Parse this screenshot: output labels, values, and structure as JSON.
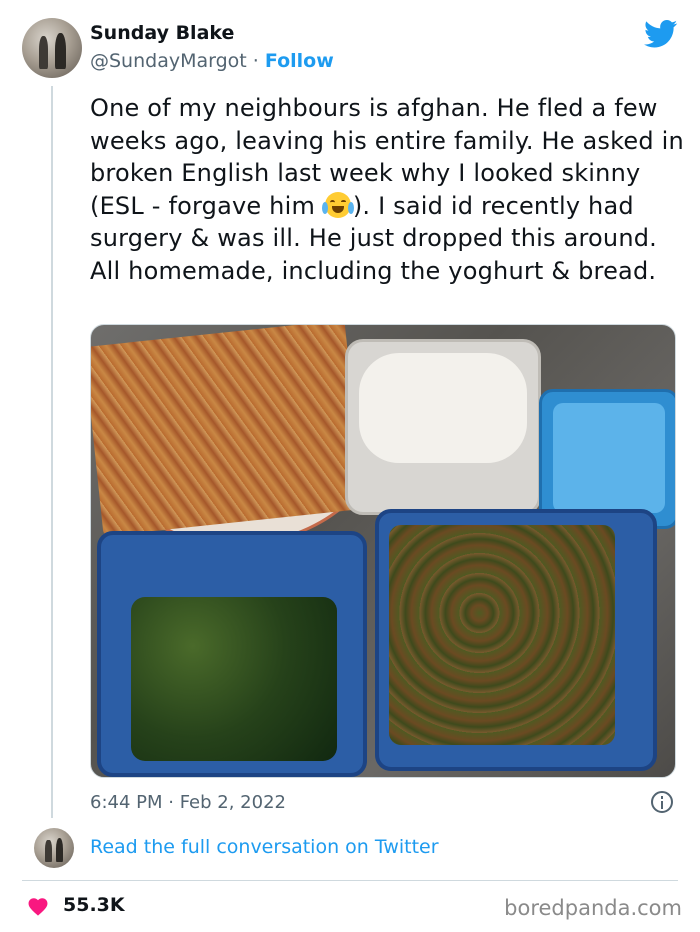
{
  "author": {
    "display_name": "Sunday Blake",
    "handle": "@SundayMargot",
    "separator": " · ",
    "follow_label": "Follow"
  },
  "tweet": {
    "text_before_emoji": "One of my neighbours is afghan. He fled a few weeks ago, leaving his entire family. He asked in broken English last week why I looked skinny (ESL - forgave him ",
    "emoji": "face-with-tears-of-joy",
    "text_after_emoji": "). I said id recently had surgery & was ill. He just dropped this around. All homemade, including the yoghurt & bread.",
    "timestamp": "6:44 PM · Feb 2, 2022"
  },
  "footer": {
    "read_link": "Read the full conversation on Twitter",
    "likes": "55.3K",
    "watermark": "boredpanda.com"
  },
  "icons": {
    "brand": "twitter-bird-icon",
    "info": "info-icon",
    "like": "heart-icon"
  },
  "colors": {
    "accent": "#1d9bf0",
    "text": "#0f1419",
    "muted": "#536471",
    "heart": "#f91880"
  }
}
